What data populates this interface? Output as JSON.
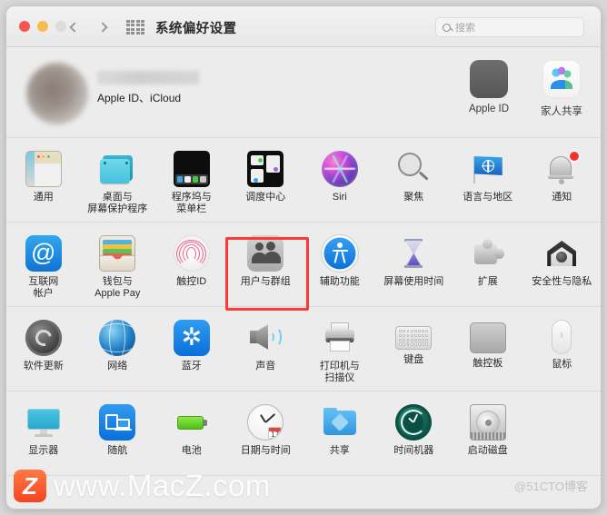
{
  "window": {
    "title": "系统偏好设置",
    "traffic_lights": [
      "close",
      "minimize",
      "zoom"
    ],
    "nav_back": "‹",
    "nav_forward": "›",
    "grid_button": "grid-icon"
  },
  "search": {
    "placeholder": "搜索",
    "value": ""
  },
  "account": {
    "name_redacted": "",
    "subtitle": "Apple ID、iCloud",
    "top_items": [
      {
        "label": "Apple ID",
        "icon": "apple-logo-icon"
      },
      {
        "label": "家人共享",
        "icon": "family-sharing-icon"
      }
    ]
  },
  "sections": [
    {
      "id": "personal",
      "items": [
        {
          "label": "通用",
          "icon": "general-icon"
        },
        {
          "label": "桌面与\n屏幕保护程序",
          "icon": "desktop-screensaver-icon"
        },
        {
          "label": "程序坞与\n菜单栏",
          "icon": "dock-menubar-icon"
        },
        {
          "label": "调度中心",
          "icon": "mission-control-icon"
        },
        {
          "label": "Siri",
          "icon": "siri-icon"
        },
        {
          "label": "聚焦",
          "icon": "spotlight-icon"
        },
        {
          "label": "语言与地区",
          "icon": "language-region-icon"
        },
        {
          "label": "通知",
          "icon": "notifications-icon"
        }
      ]
    },
    {
      "id": "accounts",
      "items": [
        {
          "label": "互联网\n帐户",
          "icon": "internet-accounts-icon"
        },
        {
          "label": "钱包与\nApple Pay",
          "icon": "wallet-applepay-icon"
        },
        {
          "label": "触控ID",
          "icon": "touch-id-icon"
        },
        {
          "label": "用户与群组",
          "icon": "users-groups-icon",
          "highlighted": true
        },
        {
          "label": "辅助功能",
          "icon": "accessibility-icon"
        },
        {
          "label": "屏幕使用时间",
          "icon": "screen-time-icon"
        },
        {
          "label": "扩展",
          "icon": "extensions-icon"
        },
        {
          "label": "安全性与隐私",
          "icon": "security-privacy-icon"
        }
      ]
    },
    {
      "id": "hardware",
      "items": [
        {
          "label": "软件更新",
          "icon": "software-update-icon"
        },
        {
          "label": "网络",
          "icon": "network-icon"
        },
        {
          "label": "蓝牙",
          "icon": "bluetooth-icon"
        },
        {
          "label": "声音",
          "icon": "sound-icon"
        },
        {
          "label": "打印机与\n扫描仪",
          "icon": "printers-scanners-icon"
        },
        {
          "label": "键盘",
          "icon": "keyboard-icon"
        },
        {
          "label": "触控板",
          "icon": "trackpad-icon"
        },
        {
          "label": "鼠标",
          "icon": "mouse-icon"
        }
      ]
    },
    {
      "id": "system",
      "items": [
        {
          "label": "显示器",
          "icon": "displays-icon"
        },
        {
          "label": "随航",
          "icon": "sidecar-icon"
        },
        {
          "label": "电池",
          "icon": "battery-icon"
        },
        {
          "label": "日期与时间",
          "icon": "date-time-icon"
        },
        {
          "label": "共享",
          "icon": "sharing-icon"
        },
        {
          "label": "时间机器",
          "icon": "time-machine-icon"
        },
        {
          "label": "启动磁盘",
          "icon": "startup-disk-icon"
        }
      ]
    }
  ],
  "date_icon_day": "17",
  "watermark": {
    "logo": "Z",
    "text": "www.MacZ.com",
    "corner": "@51CTO博客"
  },
  "colors": {
    "highlight": "#fd3a36",
    "accent_blue": "#0a6fdb",
    "window_bg": "#ececec"
  }
}
